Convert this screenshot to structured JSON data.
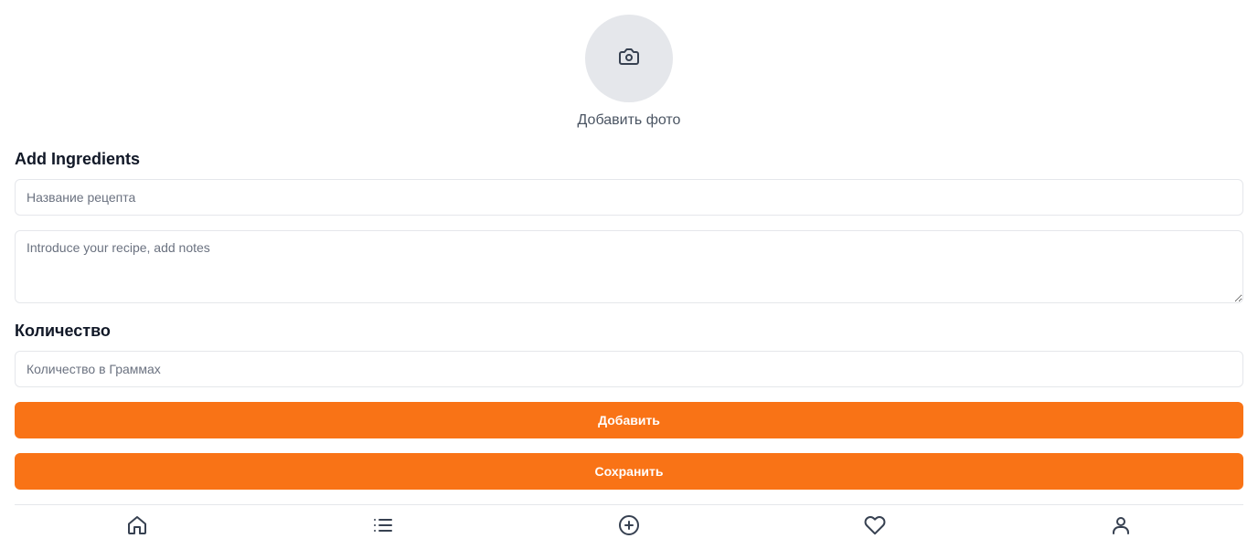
{
  "photo": {
    "label": "Добавить фото",
    "icon": "camera-icon"
  },
  "ingredients": {
    "title": "Add Ingredients",
    "name_placeholder": "Название рецепта",
    "notes_placeholder": "Introduce your recipe, add notes"
  },
  "quantity": {
    "title": "Количество",
    "placeholder": "Количество в Граммах"
  },
  "buttons": {
    "add": "Добавить",
    "save": "Сохранить"
  },
  "colors": {
    "accent": "#f97316",
    "border": "#e5e7eb",
    "muted_text": "#6b7280"
  },
  "nav": {
    "items": [
      {
        "icon": "home-icon"
      },
      {
        "icon": "list-icon"
      },
      {
        "icon": "plus-circle-icon"
      },
      {
        "icon": "heart-icon"
      },
      {
        "icon": "user-icon"
      }
    ]
  }
}
